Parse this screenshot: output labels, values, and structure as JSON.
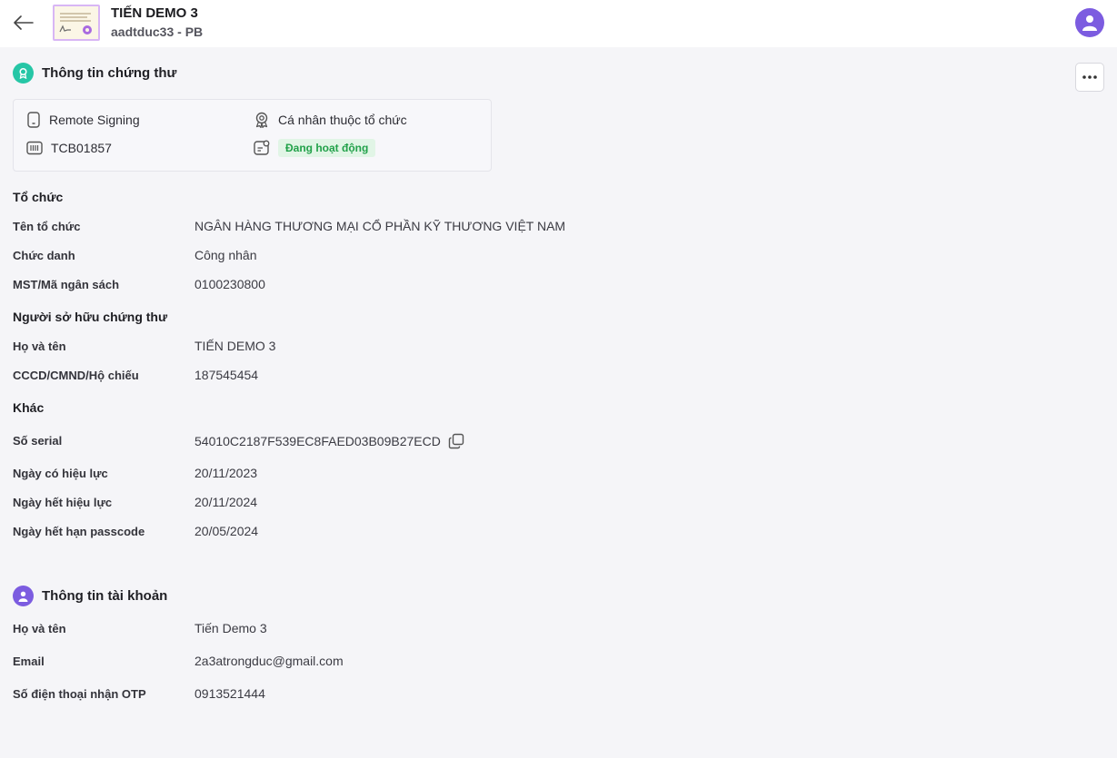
{
  "header": {
    "title": "TIẾN DEMO 3",
    "subtitle": "aadtduc33 - PB"
  },
  "cert_section": {
    "title": "Thông tin chứng thư",
    "card": {
      "signing_type": "Remote Signing",
      "holder_type": "Cá nhân thuộc tổ chức",
      "cert_code": "TCB01857",
      "status": "Đang hoạt động"
    },
    "organization": {
      "title": "Tổ chức",
      "rows": [
        {
          "label": "Tên tổ chức",
          "value": "NGÂN HÀNG THƯƠNG MẠI CỔ PHẦN KỸ THƯƠNG VIỆT NAM"
        },
        {
          "label": "Chức danh",
          "value": "Công nhân"
        },
        {
          "label": "MST/Mã ngân sách",
          "value": "0100230800"
        }
      ]
    },
    "owner": {
      "title": "Người sở hữu chứng thư",
      "rows": [
        {
          "label": "Họ và tên",
          "value": "TIẾN DEMO 3"
        },
        {
          "label": "CCCD/CMND/Hộ chiếu",
          "value": "187545454"
        }
      ]
    },
    "other": {
      "title": "Khác",
      "rows": [
        {
          "label": "Số serial",
          "value": "54010C2187F539EC8FAED03B09B27ECD"
        },
        {
          "label": "Ngày có hiệu lực",
          "value": "20/11/2023"
        },
        {
          "label": "Ngày hết hiệu lực",
          "value": "20/11/2024"
        },
        {
          "label": "Ngày hết hạn passcode",
          "value": "20/05/2024"
        }
      ]
    }
  },
  "account_section": {
    "title": "Thông tin tài khoản",
    "rows": [
      {
        "label": "Họ và tên",
        "value": "Tiến Demo 3"
      },
      {
        "label": "Email",
        "value": "2a3atrongduc@gmail.com"
      },
      {
        "label": "Số điện thoại nhận OTP",
        "value": "0913521444"
      }
    ]
  },
  "colors": {
    "accent_purple": "#7c5ce0",
    "cert_icon_teal": "#26c6a6",
    "status_green": "#22a14a",
    "status_bg": "#e1f5e6"
  }
}
